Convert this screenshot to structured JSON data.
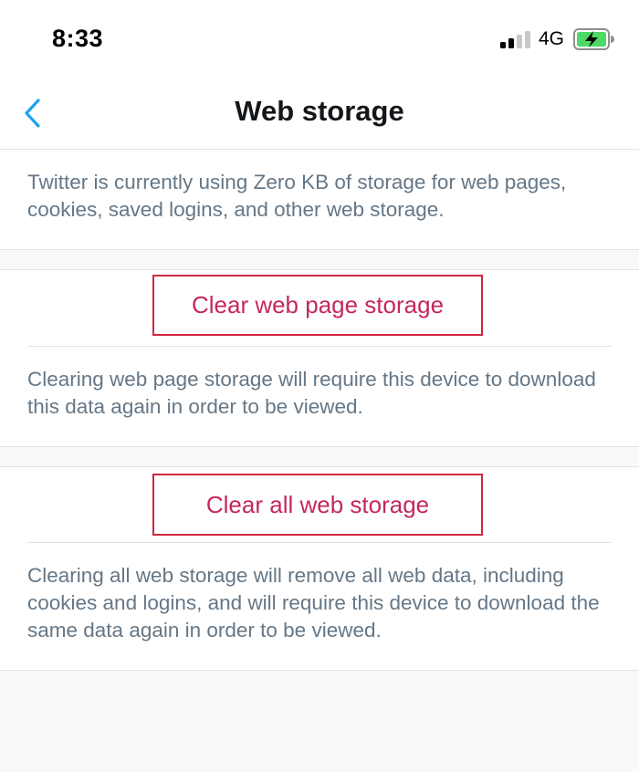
{
  "status_bar": {
    "time": "8:33",
    "network": "4G"
  },
  "nav": {
    "title": "Web storage"
  },
  "intro": {
    "text": "Twitter is currently using Zero KB of storage for web pages, cookies, saved logins, and other web storage."
  },
  "page_storage": {
    "button_label": "Clear web page storage",
    "description": "Clearing web page storage will require this device to download this data again in order to be viewed."
  },
  "all_storage": {
    "button_label": "Clear all web storage",
    "description": "Clearing all web storage will remove all web data, including cookies and logins, and will require this device to download the same data again in order to be viewed."
  },
  "colors": {
    "accent_blue": "#1da1f2",
    "destructive": "#c4285b",
    "highlight_border": "#d0273f",
    "secondary_text": "#657786",
    "battery_green": "#4cd964"
  }
}
